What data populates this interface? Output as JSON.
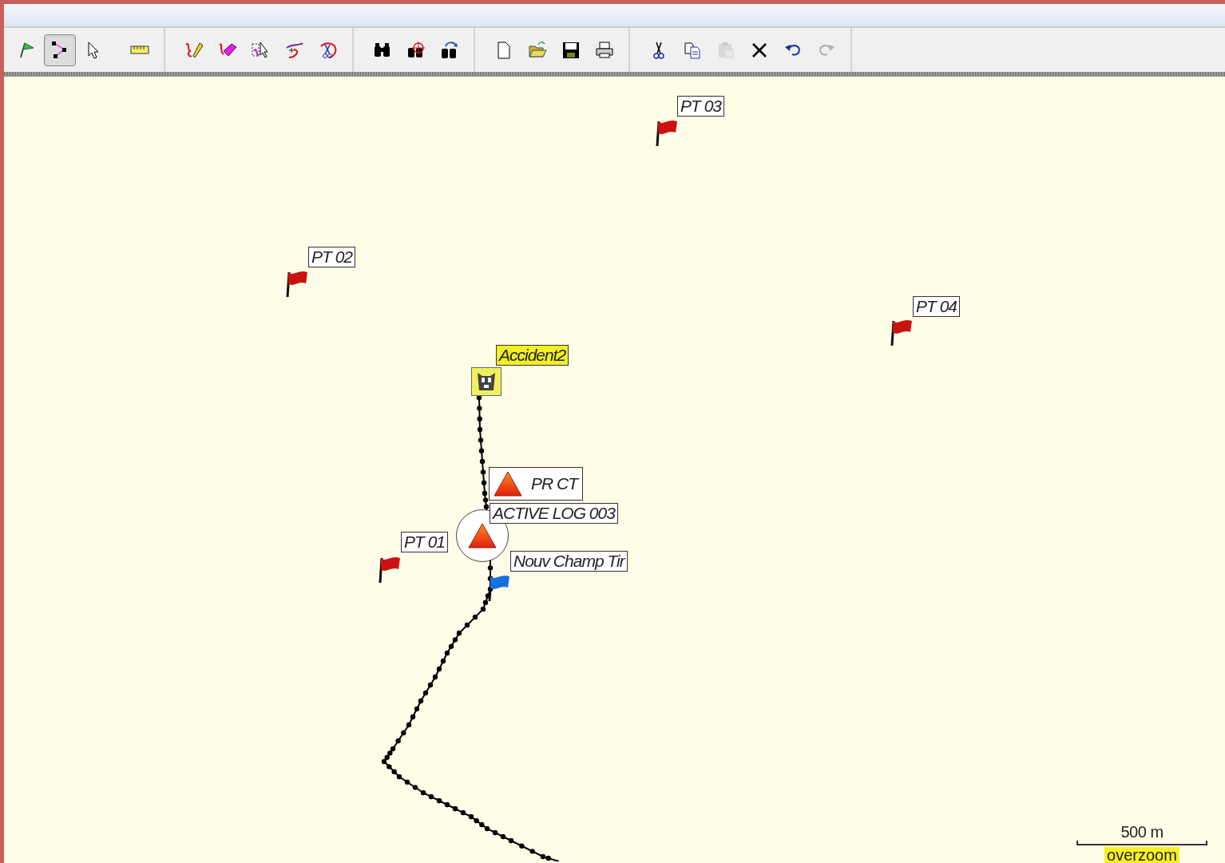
{
  "toolbar": {
    "groups": [
      [
        {
          "kind": "flag",
          "selected": false,
          "disabled": false
        },
        {
          "kind": "route",
          "selected": true,
          "disabled": false
        },
        {
          "kind": "pointer",
          "selected": false,
          "disabled": false
        },
        {
          "kind": "ruler",
          "selected": false,
          "disabled": false
        }
      ],
      [
        {
          "kind": "draw",
          "selected": false,
          "disabled": false
        },
        {
          "kind": "erase",
          "selected": false,
          "disabled": false
        },
        {
          "kind": "select",
          "selected": false,
          "disabled": false
        },
        {
          "kind": "insert",
          "selected": false,
          "disabled": false
        },
        {
          "kind": "split",
          "selected": false,
          "disabled": false
        }
      ],
      [
        {
          "kind": "find",
          "selected": false,
          "disabled": false
        },
        {
          "kind": "locate",
          "selected": false,
          "disabled": false
        },
        {
          "kind": "goto",
          "selected": false,
          "disabled": false
        }
      ],
      [
        {
          "kind": "new",
          "selected": false,
          "disabled": false
        },
        {
          "kind": "open",
          "selected": false,
          "disabled": false
        },
        {
          "kind": "save",
          "selected": false,
          "disabled": false
        },
        {
          "kind": "print",
          "selected": false,
          "disabled": false
        }
      ],
      [
        {
          "kind": "cut",
          "selected": false,
          "disabled": false
        },
        {
          "kind": "copy",
          "selected": false,
          "disabled": false
        },
        {
          "kind": "paste",
          "selected": false,
          "disabled": true
        },
        {
          "kind": "delete",
          "selected": false,
          "disabled": false
        },
        {
          "kind": "undo",
          "selected": false,
          "disabled": false
        },
        {
          "kind": "redo",
          "selected": false,
          "disabled": true
        }
      ]
    ]
  },
  "map": {
    "waypoints": [
      {
        "kind": "flag",
        "color": "#cc1111",
        "label": "PT 03",
        "highlighted": false
      },
      {
        "kind": "flag",
        "color": "#cc1111",
        "label": "PT 02",
        "highlighted": false
      },
      {
        "kind": "flag",
        "color": "#cc1111",
        "label": "PT 04",
        "highlighted": false
      },
      {
        "kind": "accident",
        "label": "Accident2",
        "highlighted": true
      },
      {
        "kind": "triangle",
        "label": "PR CT",
        "highlighted": false
      },
      {
        "kind": "triangle-circle",
        "label": "ACTIVE LOG 003",
        "highlighted": false
      },
      {
        "kind": "flag",
        "color": "#cc1111",
        "label": "PT 01",
        "highlighted": false
      },
      {
        "kind": "flag",
        "color": "#1a6fe0",
        "label": "Nouv Champ Tir",
        "highlighted": false
      }
    ],
    "scale": {
      "distance": "500 m",
      "note": "overzoom"
    }
  }
}
